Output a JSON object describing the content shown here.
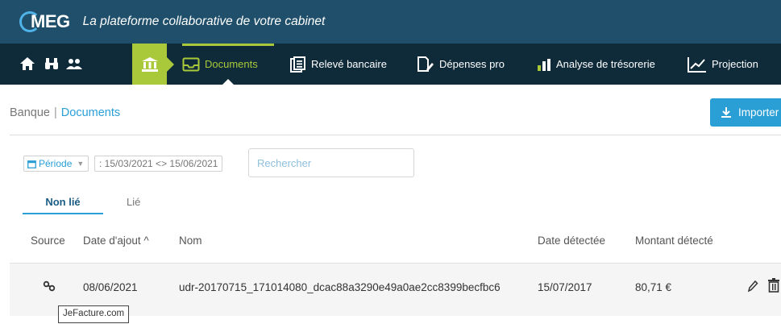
{
  "header": {
    "logo_text": "MEG",
    "tagline": "La plateforme collaborative de votre cabinet"
  },
  "nav": {
    "items": [
      {
        "label": "Documents",
        "icon": "inbox-icon",
        "active": true
      },
      {
        "label": "Relevé bancaire",
        "icon": "statement-icon"
      },
      {
        "label": "Dépenses pro",
        "icon": "receipt-icon"
      },
      {
        "label": "Analyse de trésorerie",
        "icon": "bar-chart-icon"
      },
      {
        "label": "Projection",
        "icon": "line-chart-icon"
      }
    ]
  },
  "breadcrumb": {
    "parent": "Banque",
    "separator": "|",
    "current": "Documents"
  },
  "toolbar": {
    "import_label": "Importer"
  },
  "filters": {
    "period_label": "Période",
    "period_range": ": 15/03/2021 <> 15/06/2021",
    "search_placeholder": "Rechercher"
  },
  "tabs": {
    "nonlie": "Non lié",
    "lie": "Lié"
  },
  "table": {
    "columns": {
      "source": "Source",
      "date": "Date d'ajout ^",
      "nom": "Nom",
      "detected": "Date détectée",
      "amount": "Montant détecté"
    },
    "rows": [
      {
        "date": "08/06/2021",
        "nom": "udr-20170715_171014080_dcac88a3290e49a0ae2cc8399becfbc6",
        "detected": "15/07/2017",
        "amount": "80,71 €",
        "source_tooltip": "JeFacture.com"
      }
    ]
  },
  "colors": {
    "header_bg": "#1f4f6a",
    "nav_bg": "#0f2b3a",
    "accent_green": "#a9c83a",
    "accent_blue": "#2a9fd6"
  }
}
